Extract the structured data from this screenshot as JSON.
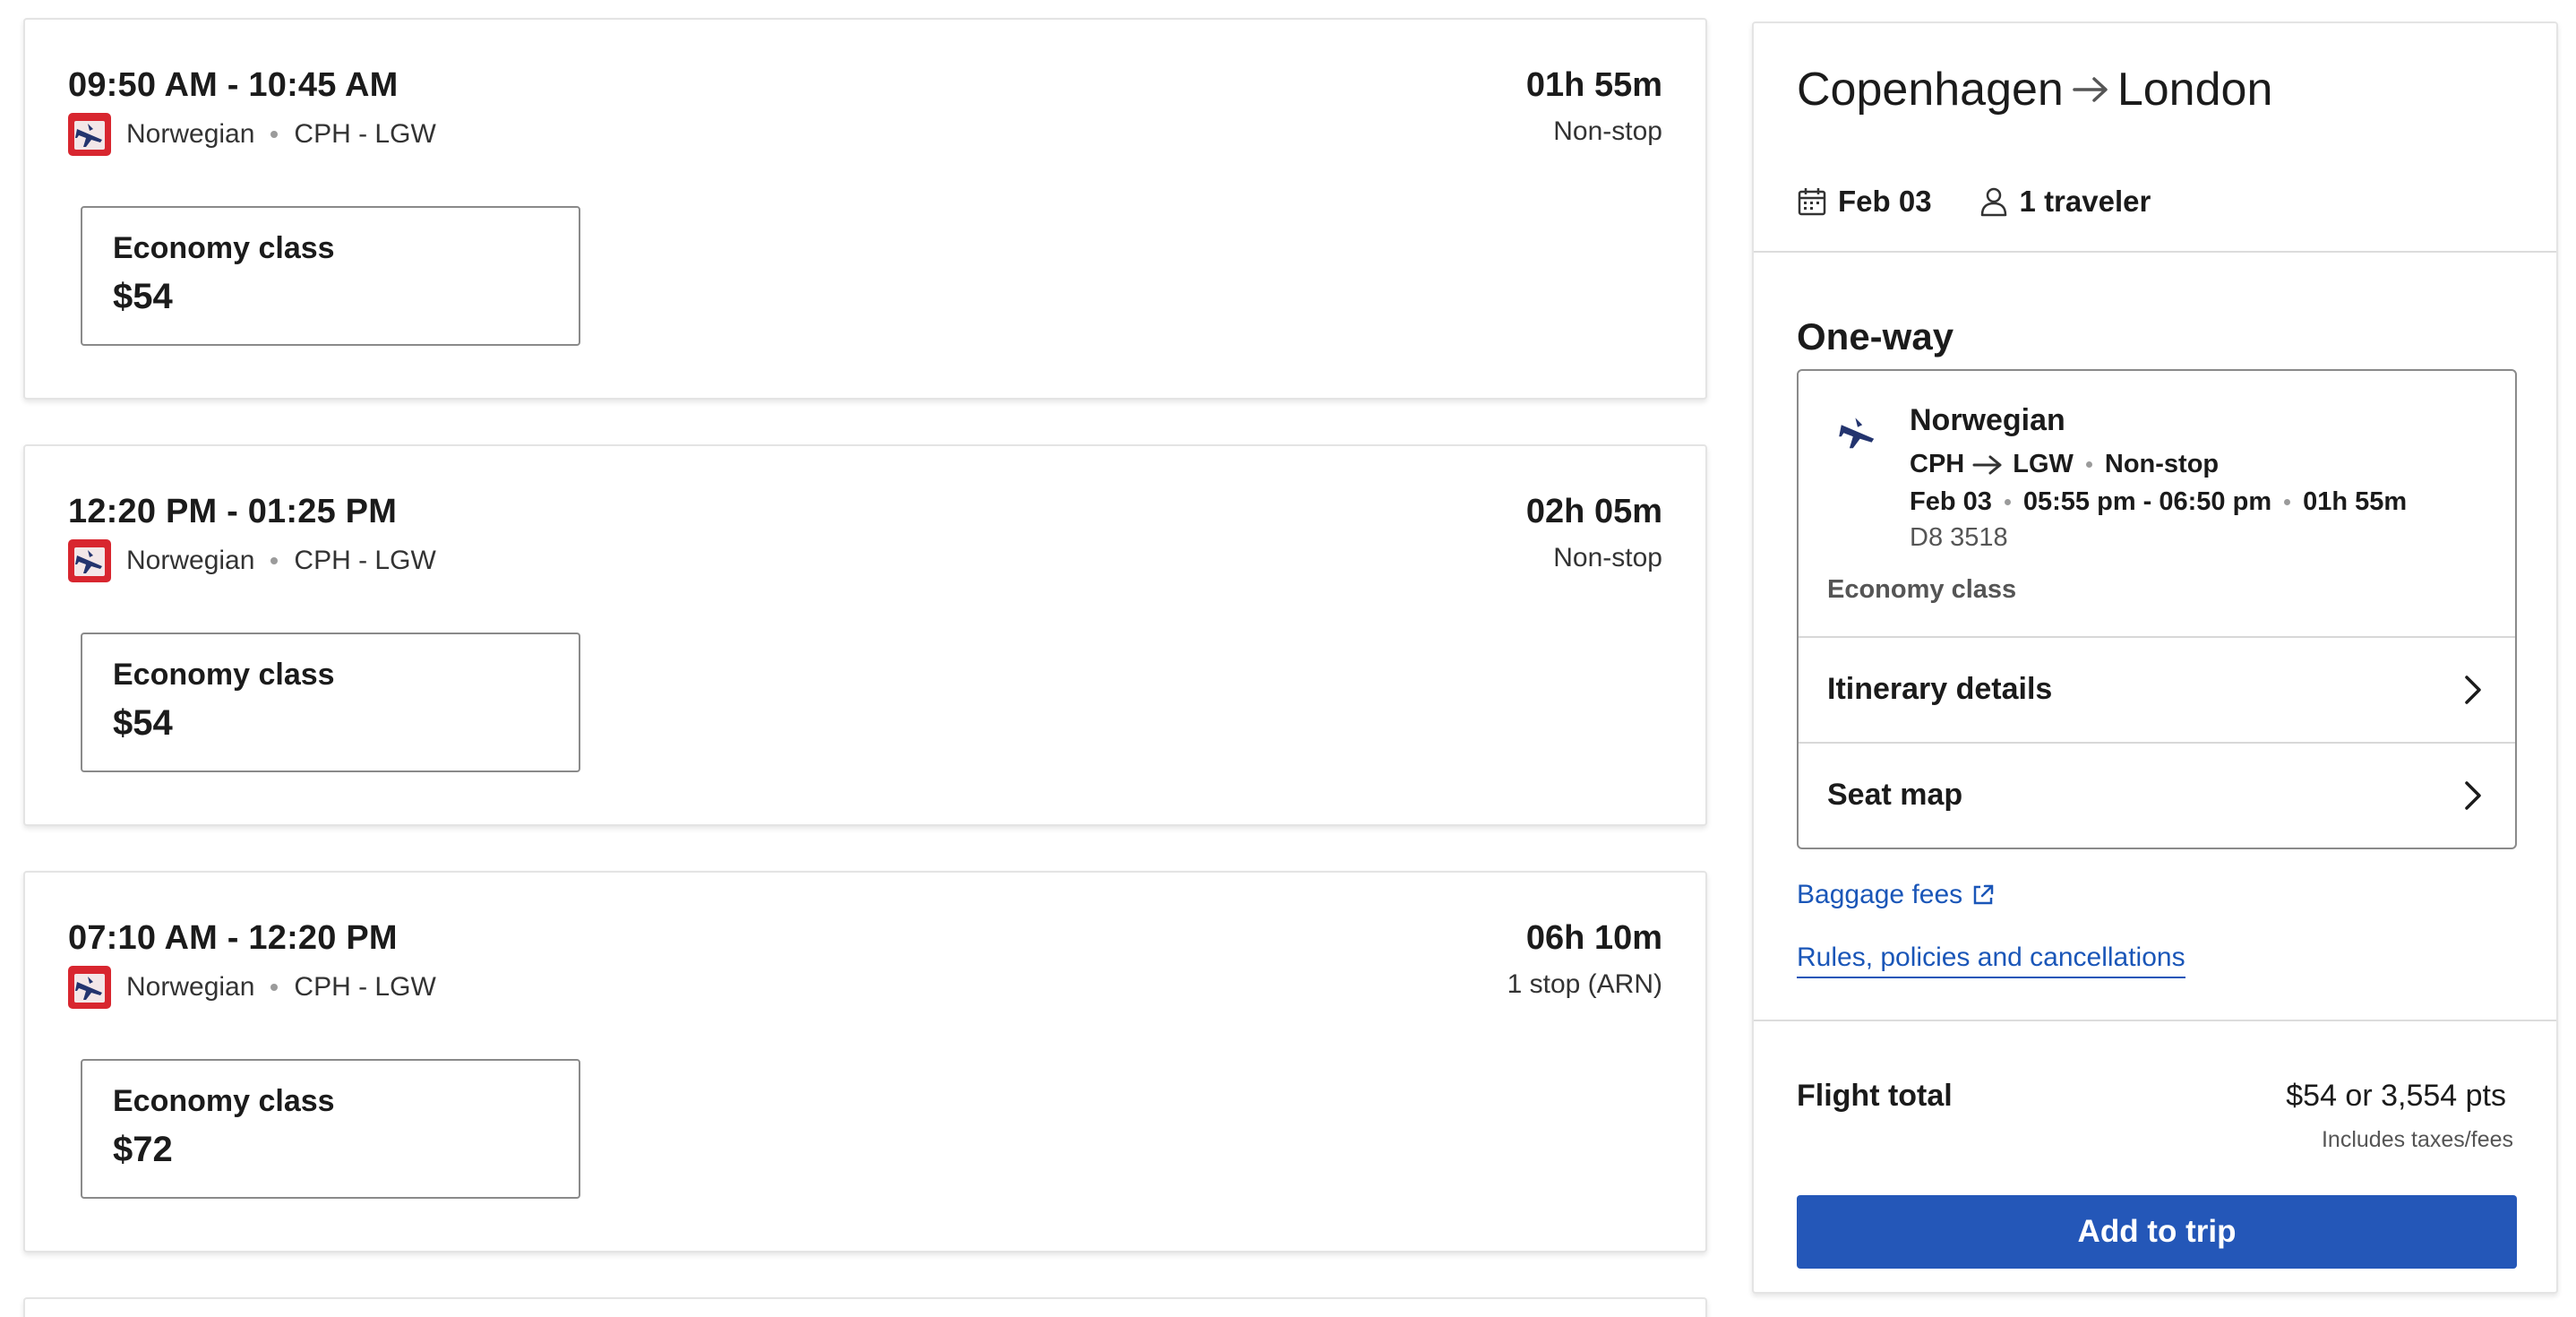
{
  "flights": [
    {
      "times": "09:50 AM - 10:45 AM",
      "airline": "Norwegian",
      "route": "CPH - LGW",
      "duration": "01h 55m",
      "stops": "Non-stop",
      "fare_class": "Economy class",
      "price": "$54"
    },
    {
      "times": "12:20 PM - 01:25 PM",
      "airline": "Norwegian",
      "route": "CPH - LGW",
      "duration": "02h 05m",
      "stops": "Non-stop",
      "fare_class": "Economy class",
      "price": "$54"
    },
    {
      "times": "07:10 AM - 12:20 PM",
      "airline": "Norwegian",
      "route": "CPH - LGW",
      "duration": "06h 10m",
      "stops": "1 stop (ARN)",
      "fare_class": "Economy class",
      "price": "$72"
    }
  ],
  "summary": {
    "origin": "Copenhagen",
    "destination": "London",
    "date": "Feb 03",
    "travelers": "1 traveler",
    "trip_type": "One-way",
    "segment": {
      "airline": "Norwegian",
      "from": "CPH",
      "to": "LGW",
      "stops": "Non-stop",
      "date": "Feb 03",
      "time_range": "05:55 pm - 06:50 pm",
      "duration": "01h 55m",
      "flight_number": "D8 3518",
      "fare_class": "Economy class"
    },
    "itinerary_label": "Itinerary details",
    "seat_map_label": "Seat map",
    "baggage_link": "Baggage fees",
    "rules_link": "Rules, policies and cancellations",
    "total_label": "Flight total",
    "total_amount": "$54 or 3,554 pts",
    "total_note": "Includes taxes/fees",
    "add_button": "Add to trip"
  },
  "colors": {
    "accent": "#2457b8",
    "link": "#1a56b8",
    "airline_brand": "#d8262f"
  },
  "icons": {
    "airline": "norwegian-logo-icon",
    "date": "calendar-icon",
    "traveler": "person-icon",
    "route_arrow": "arrow-right-icon",
    "row_chevron": "chevron-right-icon",
    "external": "external-link-icon"
  }
}
